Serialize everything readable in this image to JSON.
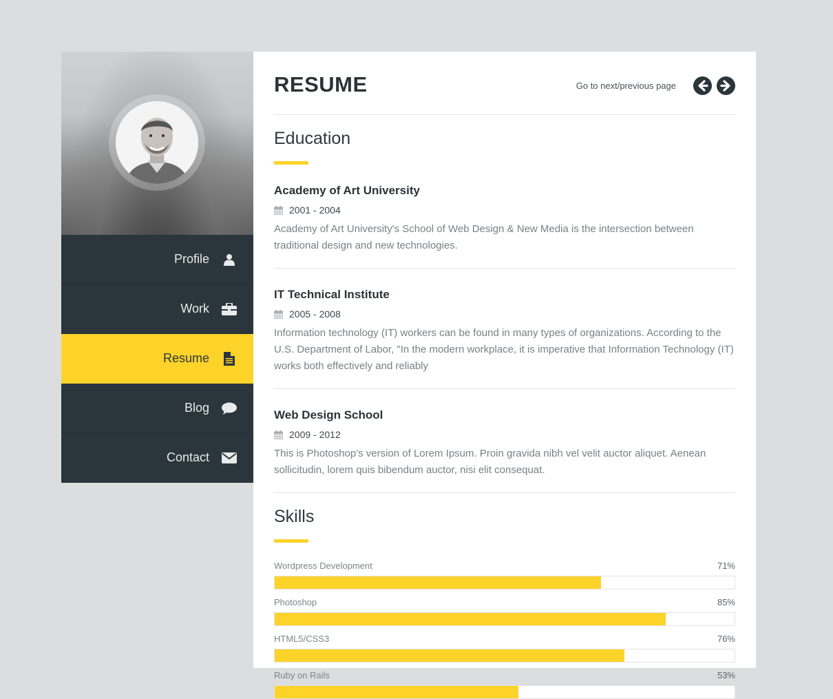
{
  "sidebar": {
    "items": [
      {
        "label": "Profile",
        "icon": "user-icon",
        "active": false
      },
      {
        "label": "Work",
        "icon": "briefcase-icon",
        "active": false
      },
      {
        "label": "Resume",
        "icon": "document-icon",
        "active": true
      },
      {
        "label": "Blog",
        "icon": "speech-bubble-icon",
        "active": false
      },
      {
        "label": "Contact",
        "icon": "envelope-icon",
        "active": false
      }
    ]
  },
  "header": {
    "title": "RESUME",
    "pager_text": "Go to next/previous page"
  },
  "education": {
    "title": "Education",
    "items": [
      {
        "name": "Academy of Art University",
        "date": "2001 - 2004",
        "description": "Academy of Art University's School of Web Design & New Media is the intersection between traditional design and new technologies."
      },
      {
        "name": "IT Technical Institute",
        "date": "2005 - 2008",
        "description": "Information technology (IT) workers can be found in many types of organizations. According to the U.S. Department of Labor, \"In the modern workplace, it is imperative that Information Technology (IT) works both effectively and reliably"
      },
      {
        "name": "Web Design School",
        "date": "2009 - 2012",
        "description": "This is Photoshop's version of Lorem Ipsum. Proin gravida nibh vel velit auctor aliquet. Aenean sollicitudin, lorem quis bibendum auctor, nisi elit consequat."
      }
    ]
  },
  "skills": {
    "title": "Skills",
    "items": [
      {
        "name": "Wordpress Development",
        "percent_label": "71%",
        "value": 71
      },
      {
        "name": "Photoshop",
        "percent_label": "85%",
        "value": 85
      },
      {
        "name": "HTML5/CSS3",
        "percent_label": "76%",
        "value": 76
      },
      {
        "name": "Ruby on Rails",
        "percent_label": "53%",
        "value": 53
      }
    ]
  },
  "colors": {
    "accent": "#fdd32a",
    "sidebar_bg": "#2b363c",
    "page_bg": "#dcdddf"
  }
}
